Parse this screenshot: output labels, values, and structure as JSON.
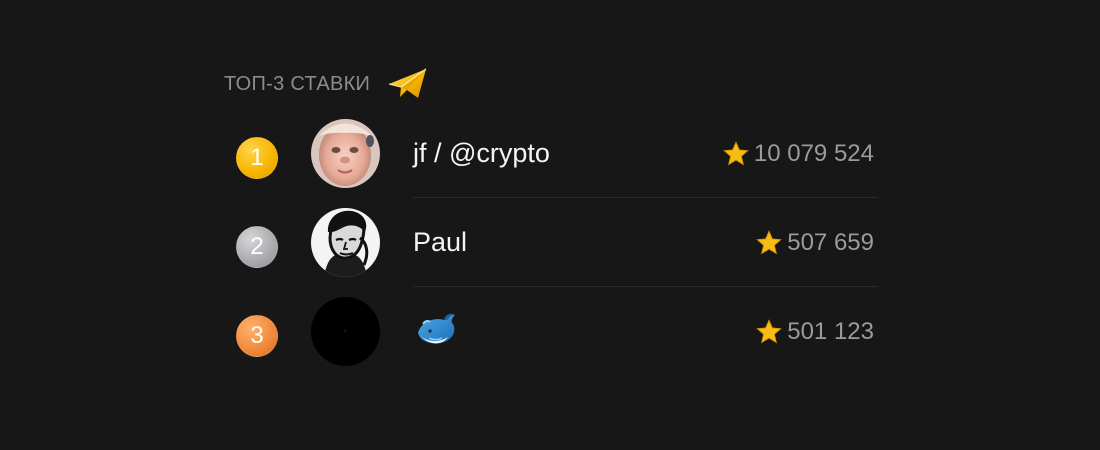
{
  "header": {
    "title": "ТОП-3 СТАВКИ",
    "icon": "paper-plane-icon"
  },
  "top_bets": [
    {
      "rank": "1",
      "name": "jf / @crypto",
      "score": "10 079 524",
      "rank_color": "#f7b500",
      "avatar": "baby-photo-avatar"
    },
    {
      "rank": "2",
      "name": "Paul",
      "score": "507 659",
      "rank_color": "#a9a9ad",
      "avatar": "man-silhouette-avatar"
    },
    {
      "rank": "3",
      "name": "",
      "name_icon": "whale-emoji-icon",
      "score": "501 123",
      "rank_color": "#ef873a",
      "avatar": "black-avatar"
    }
  ],
  "colors": {
    "background": "#171717",
    "title": "#8b8b91",
    "text": "#f4f4f4",
    "score": "#9a9aa0",
    "divider": "#2a2a2d"
  },
  "star_icon": "star-icon"
}
